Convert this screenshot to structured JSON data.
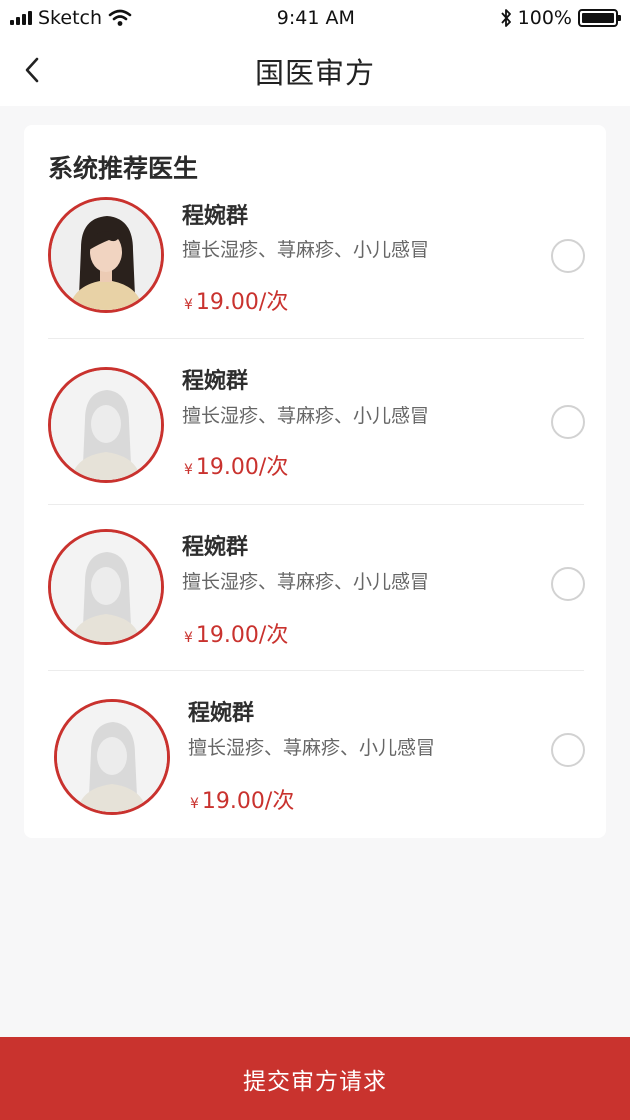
{
  "status_bar": {
    "carrier": "Sketch",
    "time": "9:41 AM",
    "battery": "100%",
    "battery_level": 1.0
  },
  "nav": {
    "back_icon": "chevron-left-icon",
    "title": "国医审方"
  },
  "recommend": {
    "section_title": "系统推荐医生",
    "doctors": [
      {
        "name": "程婉群",
        "skill": "擅长湿疹、荨麻疹、小儿感冒",
        "currency": "¥",
        "price": "19.00/次",
        "selected": false
      },
      {
        "name": "程婉群",
        "skill": "擅长湿疹、荨麻疹、小儿感冒",
        "currency": "¥",
        "price": "19.00/次",
        "selected": false
      },
      {
        "name": "程婉群",
        "skill": "擅长湿疹、荨麻疹、小儿感冒",
        "currency": "¥",
        "price": "19.00/次",
        "selected": false
      },
      {
        "name": "程婉群",
        "skill": "擅长湿疹、荨麻疹、小儿感冒",
        "currency": "¥",
        "price": "19.00/次",
        "selected": false
      }
    ]
  },
  "submit": {
    "label": "提交审方请求"
  },
  "colors": {
    "accent": "#c9332e",
    "background": "#f7f7f8"
  }
}
